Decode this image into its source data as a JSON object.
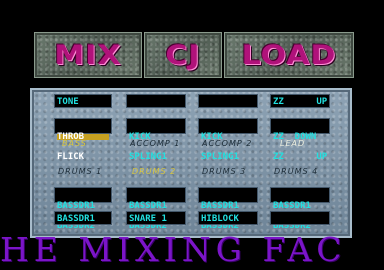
{
  "logo": {
    "part1": "MIX",
    "part2": "CJ",
    "part3": "LOAD"
  },
  "rows": {
    "tone": {
      "a": "TONE",
      "b": "",
      "c": "",
      "d": "ZZ      UP"
    },
    "flick": {
      "a1": "THROB",
      "a2": "FLICK",
      "b1": "KICK",
      "b2": "SPLING1",
      "c1": "KICK",
      "c2": "SPLING1",
      "d1": "ZZ  DOWN",
      "d2": "ZZ      UP"
    },
    "labels1": {
      "a": "BASS",
      "b": "ACCOMP 1",
      "c": "ACCOMP 2",
      "d": "LEAD"
    },
    "labels2": {
      "a": "DRUMS 1",
      "b": "DRUMS 2",
      "c": "DRUMS 3",
      "d": "DRUMS 4"
    },
    "drums": {
      "a1": "BASSDR1",
      "a2": "BASSDR2",
      "b1": "BASSDR1",
      "b2": "BASSDR2",
      "c1": "BASSDR1",
      "c2": "BASSDR2",
      "d1": "BASSDR1",
      "d2": "BASSDR2"
    },
    "bottom": {
      "a": "BASSDR1",
      "b": "SNARE 1",
      "c": "HIBLOCK",
      "d": ""
    }
  },
  "scroller": {
    "text": "HE MIXING FAC"
  }
}
